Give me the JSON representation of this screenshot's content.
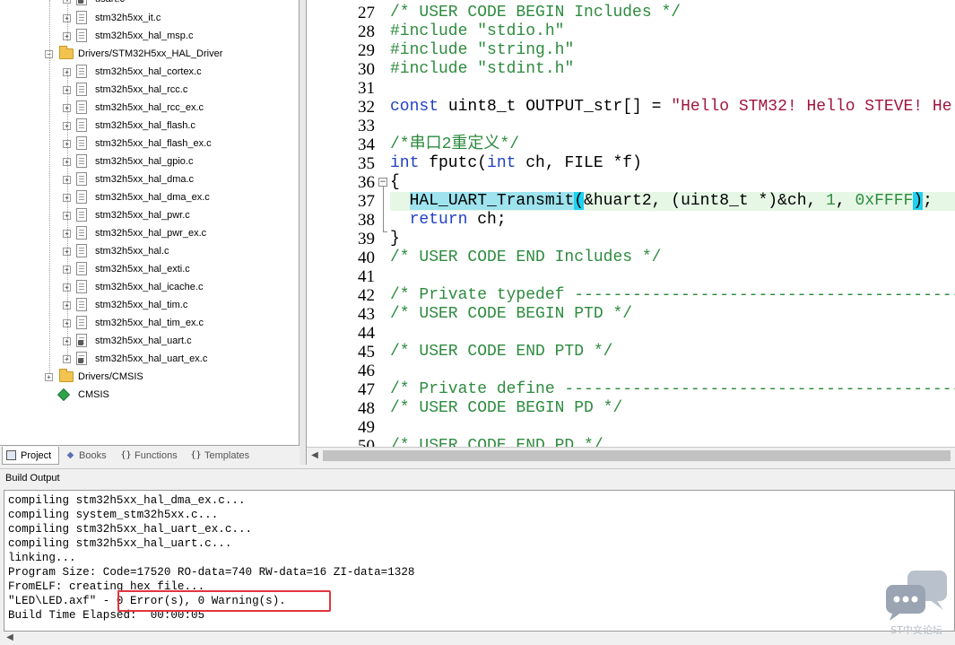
{
  "project_tree": {
    "partial_top": "usart.c",
    "items": [
      {
        "label": "stm32h5xx_it.c",
        "kind": "file"
      },
      {
        "label": "stm32h5xx_hal_msp.c",
        "kind": "file"
      },
      {
        "label": "Drivers/STM32H5xx_HAL_Driver",
        "kind": "folder-open"
      },
      {
        "label": "stm32h5xx_hal_cortex.c",
        "kind": "file"
      },
      {
        "label": "stm32h5xx_hal_rcc.c",
        "kind": "file"
      },
      {
        "label": "stm32h5xx_hal_rcc_ex.c",
        "kind": "file"
      },
      {
        "label": "stm32h5xx_hal_flash.c",
        "kind": "file"
      },
      {
        "label": "stm32h5xx_hal_flash_ex.c",
        "kind": "file"
      },
      {
        "label": "stm32h5xx_hal_gpio.c",
        "kind": "file"
      },
      {
        "label": "stm32h5xx_hal_dma.c",
        "kind": "file"
      },
      {
        "label": "stm32h5xx_hal_dma_ex.c",
        "kind": "file"
      },
      {
        "label": "stm32h5xx_hal_pwr.c",
        "kind": "file"
      },
      {
        "label": "stm32h5xx_hal_pwr_ex.c",
        "kind": "file"
      },
      {
        "label": "stm32h5xx_hal.c",
        "kind": "file"
      },
      {
        "label": "stm32h5xx_hal_exti.c",
        "kind": "file"
      },
      {
        "label": "stm32h5xx_hal_icache.c",
        "kind": "file"
      },
      {
        "label": "stm32h5xx_hal_tim.c",
        "kind": "file"
      },
      {
        "label": "stm32h5xx_hal_tim_ex.c",
        "kind": "file"
      },
      {
        "label": "stm32h5xx_hal_uart.c",
        "kind": "file-config"
      },
      {
        "label": "stm32h5xx_hal_uart_ex.c",
        "kind": "file-config"
      },
      {
        "label": "Drivers/CMSIS",
        "kind": "folder"
      },
      {
        "label": "CMSIS",
        "kind": "component"
      }
    ]
  },
  "tabs": [
    {
      "label": "Project",
      "icon": "project-icon",
      "active": true
    },
    {
      "label": "Books",
      "icon": "books-icon",
      "active": false
    },
    {
      "label": "Functions",
      "icon": "functions-icon",
      "active": false
    },
    {
      "label": "Templates",
      "icon": "templates-icon",
      "active": false
    }
  ],
  "editor": {
    "lines": [
      {
        "num": "27",
        "text": "/* USER CODE BEGIN Includes */"
      },
      {
        "num": "28",
        "text": "#include \"stdio.h\""
      },
      {
        "num": "29",
        "text": "#include \"string.h\""
      },
      {
        "num": "30",
        "text": "#include \"stdint.h\""
      },
      {
        "num": "31",
        "text": ""
      },
      {
        "num": "32",
        "text": "const uint8_t OUTPUT_str[] = \"Hello STM32! Hello STEVE! He"
      },
      {
        "num": "33",
        "text": ""
      },
      {
        "num": "34",
        "text": "/*串口2重定义*/"
      },
      {
        "num": "35",
        "text": "int fputc(int ch, FILE *f)"
      },
      {
        "num": "36",
        "text": "{"
      },
      {
        "num": "37",
        "text": "  HAL_UART_Transmit(&huart2, (uint8_t *)&ch, 1, 0xFFFF);"
      },
      {
        "num": "38",
        "text": "  return ch;"
      },
      {
        "num": "39",
        "text": "}"
      },
      {
        "num": "40",
        "text": "/* USER CODE END Includes */"
      },
      {
        "num": "41",
        "text": ""
      },
      {
        "num": "42",
        "text": "/* Private typedef -----------------------------------------------"
      },
      {
        "num": "43",
        "text": "/* USER CODE BEGIN PTD */"
      },
      {
        "num": "44",
        "text": ""
      },
      {
        "num": "45",
        "text": "/* USER CODE END PTD */"
      },
      {
        "num": "46",
        "text": ""
      },
      {
        "num": "47",
        "text": "/* Private define ------------------------------------------------"
      },
      {
        "num": "48",
        "text": "/* USER CODE BEGIN PD */"
      },
      {
        "num": "49",
        "text": ""
      },
      {
        "num": "50",
        "text": "/* USER CODE END PD */"
      }
    ]
  },
  "build_output": {
    "title": "Build Output",
    "lines": [
      "compiling stm32h5xx_hal_dma_ex.c...",
      "compiling system_stm32h5xx.c...",
      "compiling stm32h5xx_hal_uart_ex.c...",
      "compiling stm32h5xx_hal_uart.c...",
      "linking...",
      "Program Size: Code=17520 RO-data=740 RW-data=16 ZI-data=1328",
      "FromELF: creating hex file...",
      "\"LED\\LED.axf\" - 0 Error(s), 0 Warning(s).",
      "Build Time Elapsed:  00:00:05"
    ]
  },
  "watermark": {
    "text": "ST中文论坛",
    "icon": "chat-bubbles-icon"
  },
  "colors": {
    "comment": "#2e8b3f",
    "keyword": "#2142c4",
    "string": "#a0153e",
    "highlight_line": "#e6f7e6",
    "selection": "#9ee3ee",
    "error_box": "#e0353f"
  }
}
